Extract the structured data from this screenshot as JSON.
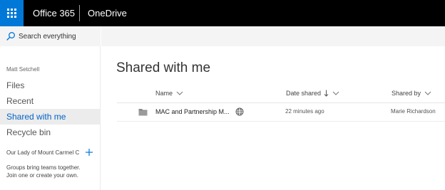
{
  "suite_bar": {
    "product_title": "Office 365",
    "app_title": "OneDrive",
    "background": "#000000",
    "waffle_color": "#0078d7"
  },
  "left_nav": {
    "search_label": "Search everything",
    "user_name": "Matt Setchell",
    "items": [
      {
        "label": "Files"
      },
      {
        "label": "Recent"
      },
      {
        "label": "Shared with me",
        "active": true
      },
      {
        "label": "Recycle bin"
      }
    ],
    "group_name": "Our Lady of Mount Carmel C",
    "groups_hint_line1": "Groups bring teams together.",
    "groups_hint_line2": "Join one or create your own."
  },
  "main": {
    "page_title": "Shared with me",
    "columns": {
      "name": "Name",
      "date_shared": "Date shared",
      "shared_by": "Shared by"
    },
    "sort": {
      "column": "date_shared",
      "direction": "descending"
    },
    "rows": [
      {
        "name": "MAC and Partnership M...",
        "date_shared": "22 minutes ago",
        "shared_by": "Marie Richardson",
        "type": "folder",
        "icon": "globe-icon"
      }
    ]
  },
  "colors": {
    "accent": "#0064c8",
    "active_bg": "#ececec",
    "band_bg": "#f4f4f4"
  }
}
